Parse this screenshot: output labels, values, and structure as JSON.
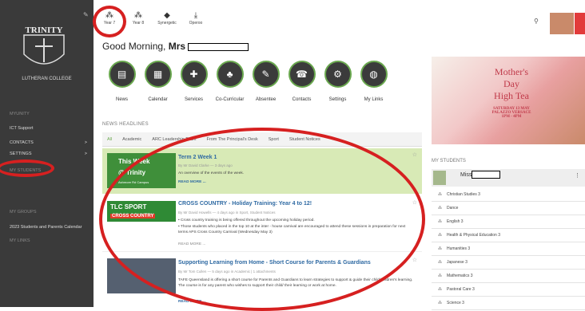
{
  "sidebar": {
    "logo_name": "TRINITY",
    "logo_sub": "LUTHERAN COLLEGE",
    "items": [
      {
        "label": "MYUNITY",
        "section": true
      },
      {
        "label": "ICT Support"
      },
      {
        "label": "CONTACTS",
        "arrow": ">"
      },
      {
        "label": "SETTINGS",
        "arrow": ">"
      },
      {
        "label": "MY STUDENTS",
        "section": true
      },
      {
        "label": "MY GROUPS",
        "section": true
      },
      {
        "label": "2023 Students and Parents Calendar"
      },
      {
        "label": "MY LINKS",
        "section": true
      }
    ]
  },
  "topbar": {
    "items": [
      {
        "label": "Year 7",
        "icon": "people-icon"
      },
      {
        "label": "Year 8",
        "icon": "people-icon"
      },
      {
        "label": "Synergetic",
        "icon": "diamond-icon"
      },
      {
        "label": "Operoo",
        "icon": "download-icon"
      }
    ]
  },
  "greeting": {
    "prefix": "Good Morning,",
    "name": "Mrs"
  },
  "quicklinks": [
    {
      "label": "News",
      "icon": "news-icon"
    },
    {
      "label": "Calendar",
      "icon": "calendar-icon"
    },
    {
      "label": "Services",
      "icon": "services-icon"
    },
    {
      "label": "Co-Curricular",
      "icon": "cocurricular-icon"
    },
    {
      "label": "Absentee",
      "icon": "absentee-icon"
    },
    {
      "label": "Contacts",
      "icon": "contacts-icon"
    },
    {
      "label": "Settings",
      "icon": "settings-icon"
    },
    {
      "label": "My Links",
      "icon": "globe-icon"
    }
  ],
  "news": {
    "heading": "NEWS HEADLINES",
    "tabs": [
      "All",
      "Academic",
      "ARC Leadership Team",
      "From The Principal's Desk",
      "Sport",
      "Student Notices"
    ],
    "cards": [
      {
        "title": "Term 2 Week 1",
        "meta": "By Mr David Clarke — 3 days ago",
        "body": "An overview of the events of the week.",
        "more": "READ MORE ...",
        "thumb_a": "This Week",
        "thumb_b": "@ Trinity",
        "thumb_c": "Ashmore Rd Campus"
      },
      {
        "title": "CROSS COUNTRY - Holiday Training: Year 4 to 12!",
        "meta": "By Mr David Howells — 4 days ago in Sport, Student Notices",
        "body1": "• Cross country training is being offered throughout the upcoming holiday period.",
        "body2": "• Those students who placed in the top 10 at the inter - house carnival are encouraged to attend these sessions in preparation for next terms APS Cross Country Carnival (Wednesday May 3)",
        "more": "READ MORE ...",
        "thumb_a": "TLC SPORT",
        "thumb_b": "CROSS COUNTRY"
      },
      {
        "title": "Supporting Learning from Home - Short Course for Parents & Guardians",
        "meta": "By Mr Tom Cullen — 5 days ago in Academic | 1 attachments",
        "body": "TAFE Queensland is offering a short course for Parents and Guardians to learn strategies to support & guide their child/children's learning. The course is for any parent who wishes to support their child/ their learning or work at home.",
        "more": "READ MORE ..."
      }
    ]
  },
  "banner": {
    "line1": "Mother's",
    "line2": "Day",
    "line3": "High Tea",
    "date": "SATURDAY 13 MAY",
    "venue": "PALAZZO VERSACE",
    "time": "1PM - 4PM"
  },
  "my_students": {
    "heading": "MY STUDENTS",
    "name": "Miss",
    "subjects": [
      "Christian Studies 3",
      "Dance",
      "English 3",
      "Health & Physical Education 3",
      "Humanities 3",
      "Japanese 3",
      "Mathematics 3",
      "Pastoral Care 3",
      "Science 3"
    ]
  }
}
